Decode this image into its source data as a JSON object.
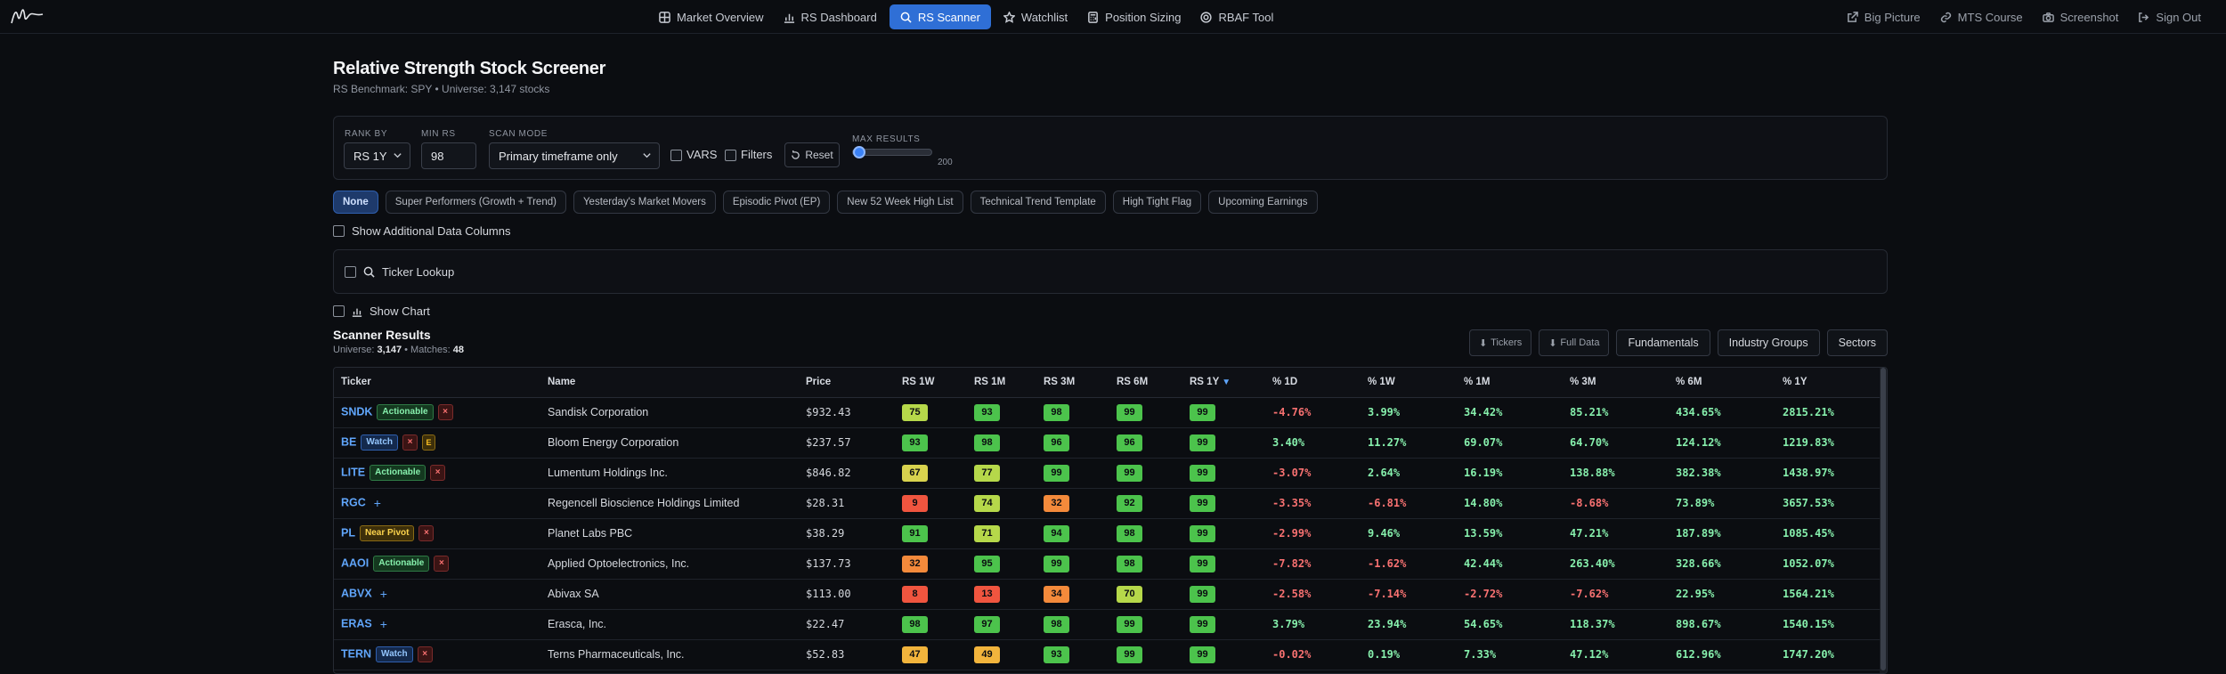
{
  "nav": {
    "items": [
      {
        "label": "Market Overview",
        "icon": "grid-icon",
        "active": false
      },
      {
        "label": "RS Dashboard",
        "icon": "bar-chart-icon",
        "active": false
      },
      {
        "label": "RS Scanner",
        "icon": "search-icon",
        "active": true
      },
      {
        "label": "Watchlist",
        "icon": "star-icon",
        "active": false
      },
      {
        "label": "Position Sizing",
        "icon": "calculator-icon",
        "active": false
      },
      {
        "label": "RBAF Tool",
        "icon": "globe-icon",
        "active": false
      }
    ],
    "right": [
      {
        "label": "Big Picture",
        "icon": "external-link-icon"
      },
      {
        "label": "MTS Course",
        "icon": "link-icon"
      },
      {
        "label": "Screenshot",
        "icon": "camera-icon"
      },
      {
        "label": "Sign Out",
        "icon": "sign-out-icon"
      }
    ]
  },
  "page": {
    "title": "Relative Strength Stock Screener",
    "subtitle": "RS Benchmark: SPY • Universe: 3,147 stocks"
  },
  "controls": {
    "rank_by_label": "RANK BY",
    "rank_by_value": "RS 1Y",
    "min_rs_label": "MIN RS",
    "min_rs_value": "98",
    "scan_mode_label": "SCAN MODE",
    "scan_mode_value": "Primary timeframe only",
    "vars_label": "VARS",
    "filters_label": "Filters",
    "reset_label": "Reset",
    "max_results_label": "MAX RESULTS",
    "max_results_value": "200",
    "max_results_fraction": 0.0
  },
  "presets": [
    "None",
    "Super Performers (Growth + Trend)",
    "Yesterday's Market Movers",
    "Episodic Pivot (EP)",
    "New 52 Week High List",
    "Technical Trend Template",
    "High Tight Flag",
    "Upcoming Earnings"
  ],
  "options": {
    "additional_columns_label": "Show Additional Data Columns",
    "ticker_lookup_label": "Ticker Lookup",
    "show_chart_label": "Show Chart"
  },
  "results": {
    "title": "Scanner Results",
    "universe_label": "Universe:",
    "universe_value": "3,147",
    "matches_label": "• Matches:",
    "matches_value": "48",
    "tickers_btn": "Tickers",
    "full_data_btn": "Full Data",
    "fundamentals_btn": "Fundamentals",
    "industry_groups_btn": "Industry Groups",
    "sectors_btn": "Sectors"
  },
  "table": {
    "headers": [
      "Ticker",
      "Name",
      "Price",
      "RS 1W",
      "RS 1M",
      "RS 3M",
      "RS 6M",
      "RS 1Y",
      "% 1D",
      "% 1W",
      "% 1M",
      "% 3M",
      "% 6M",
      "% 1Y"
    ],
    "sort_indicator": "▼",
    "rows": [
      {
        "ticker": "SNDK",
        "badges": [
          "Actionable",
          "x"
        ],
        "name": "Sandisk Corporation",
        "price": "$932.43",
        "rs": [
          "75",
          "93",
          "98",
          "99",
          "99"
        ],
        "pct": [
          "-4.76%",
          "3.99%",
          "34.42%",
          "85.21%",
          "434.65%",
          "2815.21%"
        ]
      },
      {
        "ticker": "BE",
        "badges": [
          "Watch",
          "x",
          "E"
        ],
        "name": "Bloom Energy Corporation",
        "price": "$237.57",
        "rs": [
          "93",
          "98",
          "96",
          "96",
          "99"
        ],
        "pct": [
          "3.40%",
          "11.27%",
          "69.07%",
          "64.70%",
          "124.12%",
          "1219.83%"
        ]
      },
      {
        "ticker": "LITE",
        "badges": [
          "Actionable",
          "x"
        ],
        "name": "Lumentum Holdings Inc.",
        "price": "$846.82",
        "rs": [
          "67",
          "77",
          "99",
          "99",
          "99"
        ],
        "pct": [
          "-3.07%",
          "2.64%",
          "16.19%",
          "138.88%",
          "382.38%",
          "1438.97%"
        ]
      },
      {
        "ticker": "RGC",
        "badges": [
          "+"
        ],
        "name": "Regencell Bioscience Holdings Limited",
        "price": "$28.31",
        "rs": [
          "9",
          "74",
          "32",
          "92",
          "99"
        ],
        "pct": [
          "-3.35%",
          "-6.81%",
          "14.80%",
          "-8.68%",
          "73.89%",
          "3657.53%"
        ]
      },
      {
        "ticker": "PL",
        "badges": [
          "Near Pivot",
          "x"
        ],
        "name": "Planet Labs PBC",
        "price": "$38.29",
        "rs": [
          "91",
          "71",
          "94",
          "98",
          "99"
        ],
        "pct": [
          "-2.99%",
          "9.46%",
          "13.59%",
          "47.21%",
          "187.89%",
          "1085.45%"
        ]
      },
      {
        "ticker": "AAOI",
        "badges": [
          "Actionable",
          "x"
        ],
        "name": "Applied Optoelectronics, Inc.",
        "price": "$137.73",
        "rs": [
          "32",
          "95",
          "99",
          "98",
          "99"
        ],
        "pct": [
          "-7.82%",
          "-1.62%",
          "42.44%",
          "263.40%",
          "328.66%",
          "1052.07%"
        ]
      },
      {
        "ticker": "ABVX",
        "badges": [
          "+"
        ],
        "name": "Abivax SA",
        "price": "$113.00",
        "rs": [
          "8",
          "13",
          "34",
          "70",
          "99"
        ],
        "pct": [
          "-2.58%",
          "-7.14%",
          "-2.72%",
          "-7.62%",
          "22.95%",
          "1564.21%"
        ]
      },
      {
        "ticker": "ERAS",
        "badges": [
          "+"
        ],
        "name": "Erasca, Inc.",
        "price": "$22.47",
        "rs": [
          "98",
          "97",
          "98",
          "99",
          "99"
        ],
        "pct": [
          "3.79%",
          "23.94%",
          "54.65%",
          "118.37%",
          "898.67%",
          "1540.15%"
        ]
      },
      {
        "ticker": "TERN",
        "badges": [
          "Watch",
          "x"
        ],
        "name": "Terns Pharmaceuticals, Inc.",
        "price": "$52.83",
        "rs": [
          "47",
          "49",
          "93",
          "99",
          "99"
        ],
        "pct": [
          "-0.02%",
          "0.19%",
          "7.33%",
          "47.12%",
          "612.96%",
          "1747.20%"
        ]
      }
    ]
  }
}
